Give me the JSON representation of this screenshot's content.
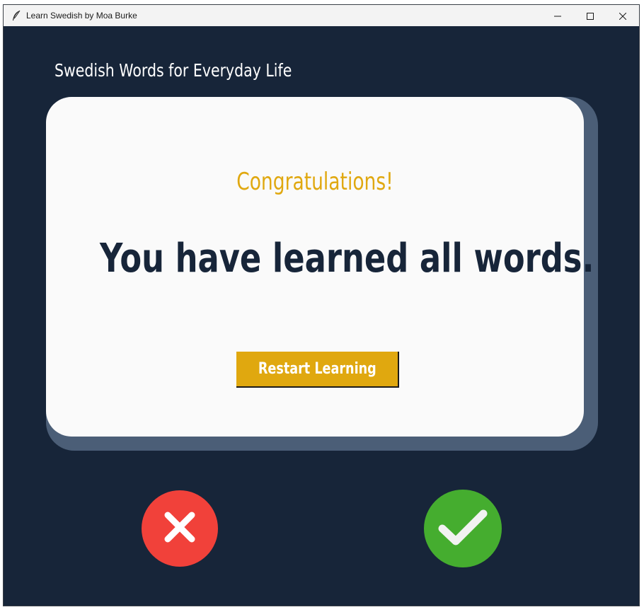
{
  "window": {
    "title": "Learn Swedish by Moa Burke",
    "app_icon": "feather-icon",
    "controls": [
      "minimize-icon",
      "maximize-icon",
      "close-icon"
    ]
  },
  "header": {
    "title": "Swedish Words for Everyday Life"
  },
  "card": {
    "subtitle": "Congratulations!",
    "message": "You have learned all words.",
    "button_label": "Restart Learning"
  },
  "actions": {
    "wrong_icon": "cross-icon",
    "right_icon": "check-icon"
  },
  "colors": {
    "background": "#172539",
    "card": "#fafafa",
    "card_shadow": "#4b5e77",
    "accent": "#e0a810",
    "wrong": "#f1413a",
    "right": "#45ad2f"
  }
}
